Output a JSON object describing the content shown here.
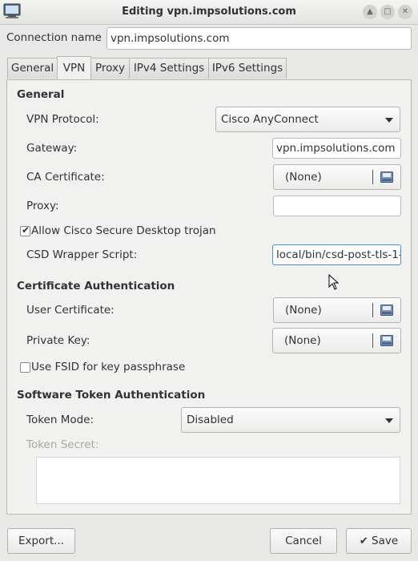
{
  "window": {
    "title": "Editing vpn.impsolutions.com",
    "buttons": [
      "up-icon",
      "restore-icon",
      "close-icon"
    ]
  },
  "connection": {
    "name_label": "Connection name",
    "name_value": "vpn.impsolutions.com"
  },
  "tabs": [
    {
      "label": "General",
      "active": false
    },
    {
      "label": "VPN",
      "active": true
    },
    {
      "label": "Proxy",
      "active": false
    },
    {
      "label": "IPv4 Settings",
      "active": false
    },
    {
      "label": "IPv6 Settings",
      "active": false
    }
  ],
  "vpn": {
    "general_heading": "General",
    "protocol_label": "VPN Protocol:",
    "protocol_value": "Cisco AnyConnect",
    "gateway_label": "Gateway:",
    "gateway_value": "vpn.impsolutions.com",
    "ca_label": "CA Certificate:",
    "ca_value": "(None)",
    "proxy_label": "Proxy:",
    "proxy_value": "",
    "csd_checkbox_label": "Allow Cisco Secure Desktop trojan",
    "csd_checked": true,
    "csd_wrapper_label": "CSD Wrapper Script:",
    "csd_wrapper_value": "local/bin/csd-post-tls-1-"
  },
  "cert_auth": {
    "heading": "Certificate Authentication",
    "user_cert_label": "User Certificate:",
    "user_cert_value": "(None)",
    "private_key_label": "Private Key:",
    "private_key_value": "(None)",
    "fsid_label": "Use FSID for key passphrase",
    "fsid_checked": false
  },
  "token_auth": {
    "heading": "Software Token Authentication",
    "mode_label": "Token Mode:",
    "mode_value": "Disabled",
    "secret_label": "Token Secret:",
    "secret_value": ""
  },
  "footer": {
    "export_label": "Export...",
    "cancel_label": "Cancel",
    "save_label": "Save"
  },
  "colors": {
    "background": "#e8e8e7",
    "text": "#2e3436",
    "disabled_text": "#a8a8a6"
  }
}
